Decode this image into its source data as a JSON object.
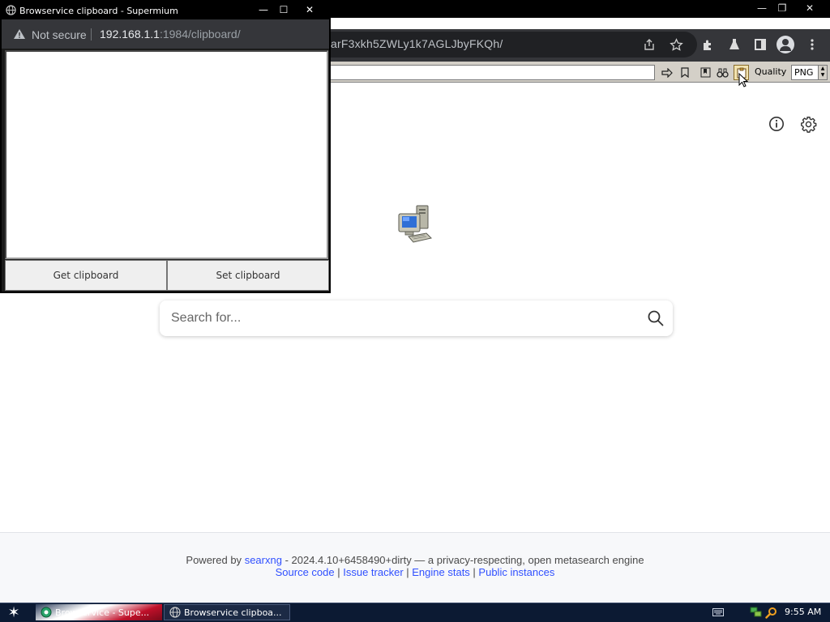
{
  "main_window": {
    "url_tail": "arF3xkh5ZWLy1k7AGLJbyFKQh/",
    "controls": {
      "minimize": "—",
      "restore": "❐",
      "close": "✕"
    }
  },
  "browservice": {
    "quality_label": "Quality",
    "quality_value": "PNG"
  },
  "search": {
    "placeholder": "Search for..."
  },
  "footer": {
    "powered_by": "Powered by",
    "engine_name": "searxng",
    "version_text": "- 2024.4.10+6458490+dirty — a privacy-respecting, open metasearch engine",
    "links": [
      "Source code",
      "Issue tracker",
      "Engine stats",
      "Public instances"
    ],
    "separator": " | "
  },
  "popup": {
    "title": "Browservice clipboard - Supermium",
    "security_label": "Not secure",
    "url_host": "192.168.1.1",
    "url_path": ":1984/clipboard/",
    "clipboard_text": "",
    "get_button": "Get clipboard",
    "set_button": "Set clipboard",
    "controls": {
      "minimize": "—",
      "maximize": "☐",
      "close": "✕"
    }
  },
  "taskbar": {
    "tasks": [
      {
        "label": "Browservice - Supe..."
      },
      {
        "label": "Browservice clipboa..."
      }
    ],
    "clock": "9:55 AM"
  },
  "colors": {
    "link": "#3050ff",
    "toolbar_dark": "#35363a",
    "taskbar": "#0c1a33",
    "browservice_bar": "#d4d0c8"
  }
}
